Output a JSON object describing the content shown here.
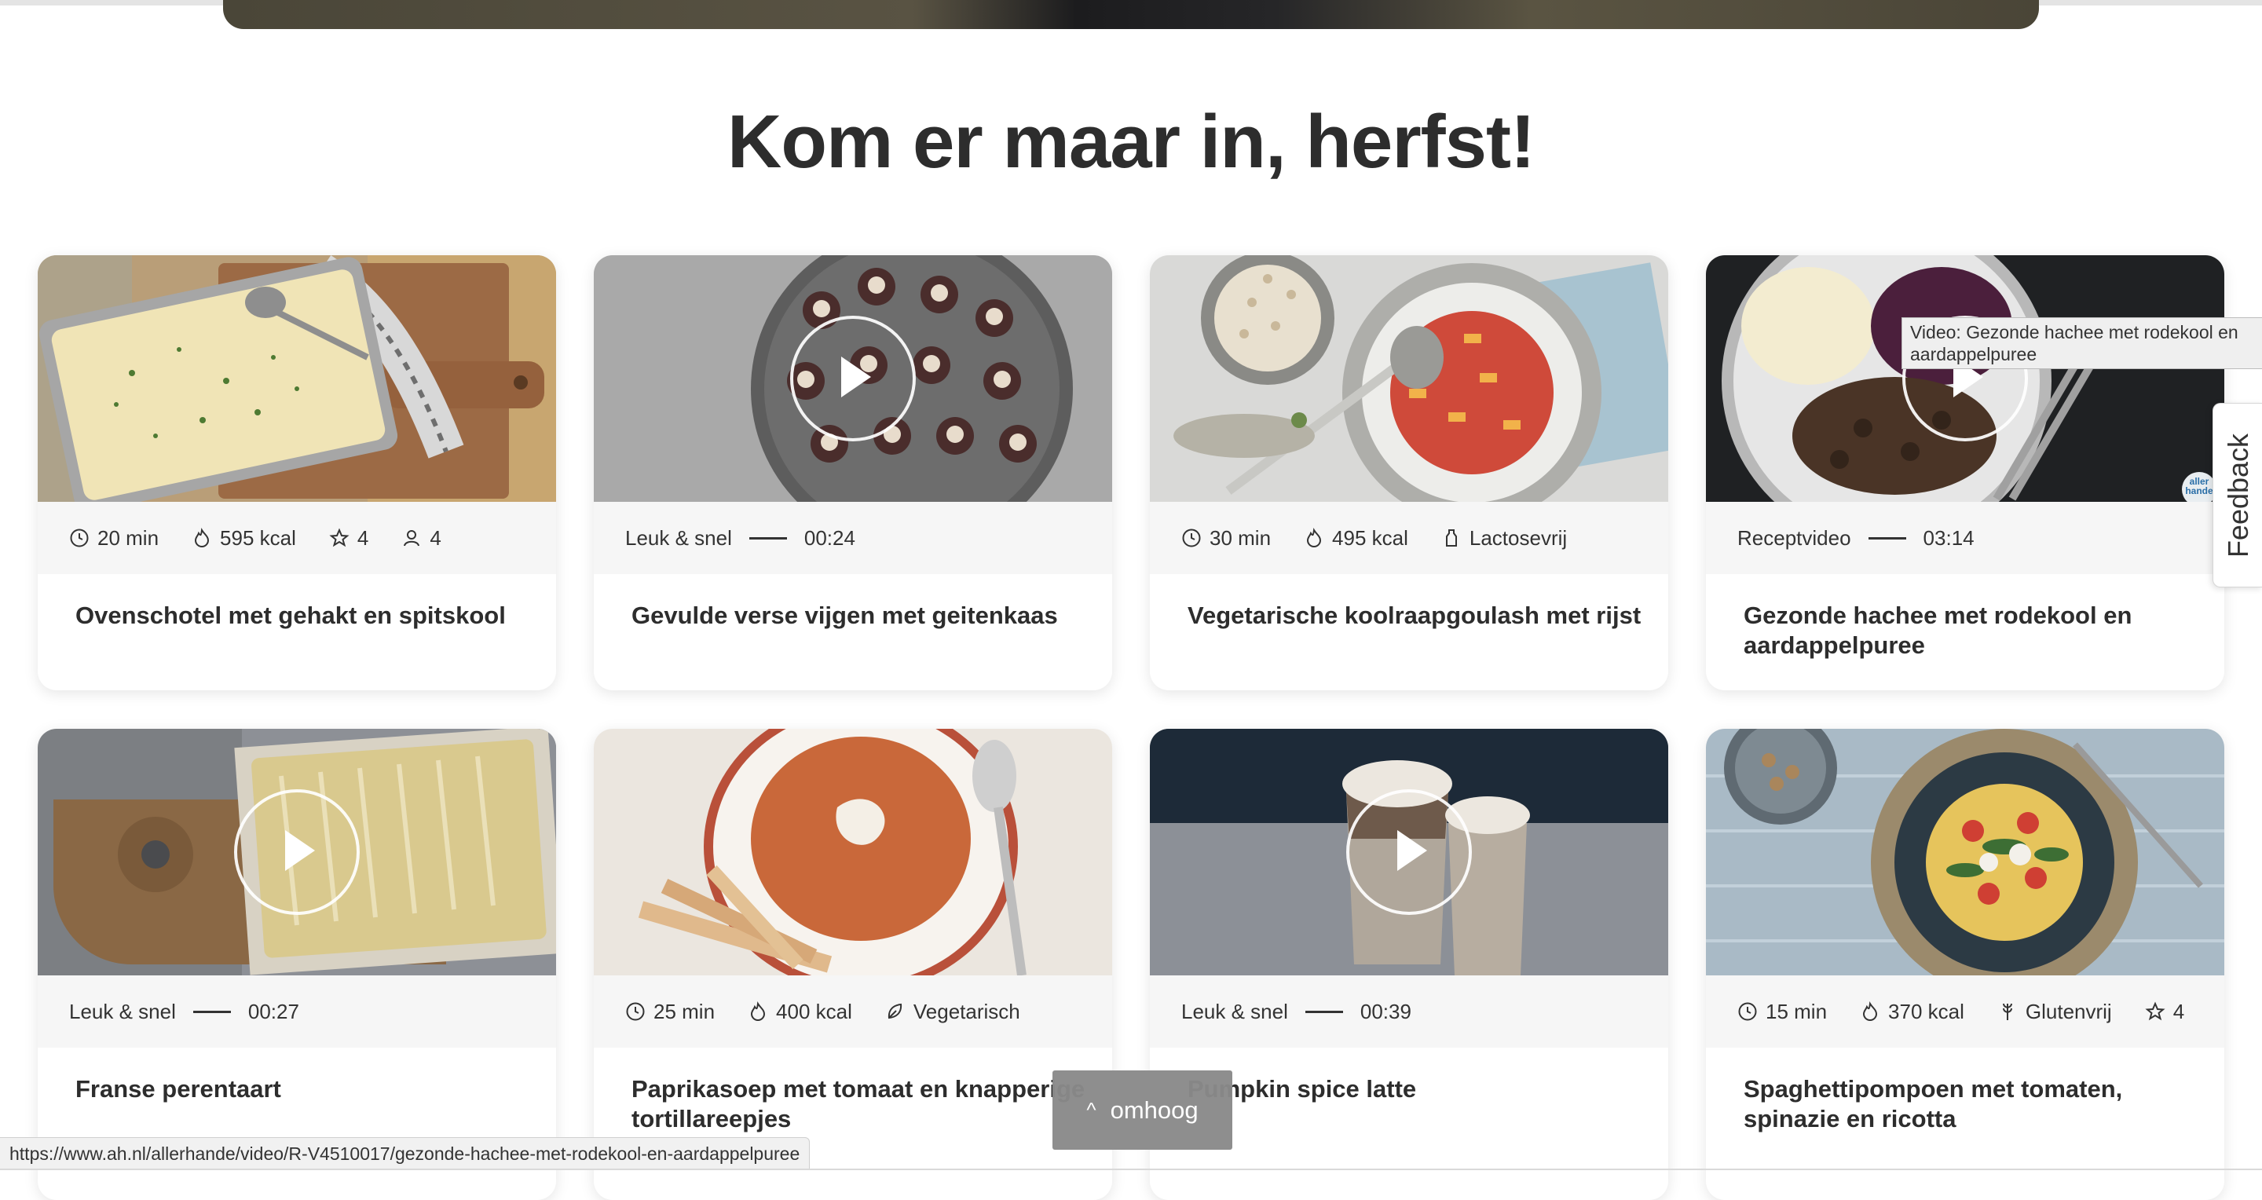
{
  "section": {
    "headline": "Kom er maar in, herfst!"
  },
  "cards": [
    {
      "title": "Ovenschotel met gehakt en spitskool",
      "meta": [
        "20 min",
        "595 kcal",
        "4",
        "4"
      ]
    },
    {
      "title": "Gevulde verse vijgen met geitenkaas",
      "category": "Leuk & snel",
      "duration": "00:24"
    },
    {
      "title": "Vegetarische koolraapgoulash met rijst",
      "meta": [
        "30 min",
        "495 kcal",
        "Lactosevrij"
      ]
    },
    {
      "title": "Gezonde hachee met rodekool en aardappelpuree",
      "category": "Receptvideo",
      "duration": "03:14"
    },
    {
      "title": "Franse perentaart",
      "category": "Leuk & snel",
      "duration": "00:27"
    },
    {
      "title": "Paprikasoep met tomaat en knapperige tortillareepjes",
      "meta": [
        "25 min",
        "400 kcal",
        "Vegetarisch"
      ]
    },
    {
      "title": "Pumpkin spice latte",
      "category": "Leuk & snel",
      "duration": "00:39"
    },
    {
      "title": "Spaghettipompoen met tomaten, spinazie en ricotta",
      "meta": [
        "15 min",
        "370 kcal",
        "Glutenvrij",
        "4"
      ]
    }
  ],
  "tooltip": "Video: Gezonde hachee met rodekool en aardappelpuree",
  "brand_badge": {
    "line1": "aller",
    "line2": "hande"
  },
  "feedback_label": "Feedback",
  "back_to_top": {
    "label": "omhoog",
    "chevron": "^"
  },
  "status_url": "https://www.ah.nl/allerhande/video/R-V4510017/gezonde-hachee-met-rodekool-en-aardappelpuree",
  "icons": [
    "clock-icon",
    "calories-icon",
    "star-icon",
    "person-icon",
    "bottle-icon",
    "leaf-icon",
    "wheat-icon",
    "play-icon",
    "chevron-up-icon"
  ]
}
